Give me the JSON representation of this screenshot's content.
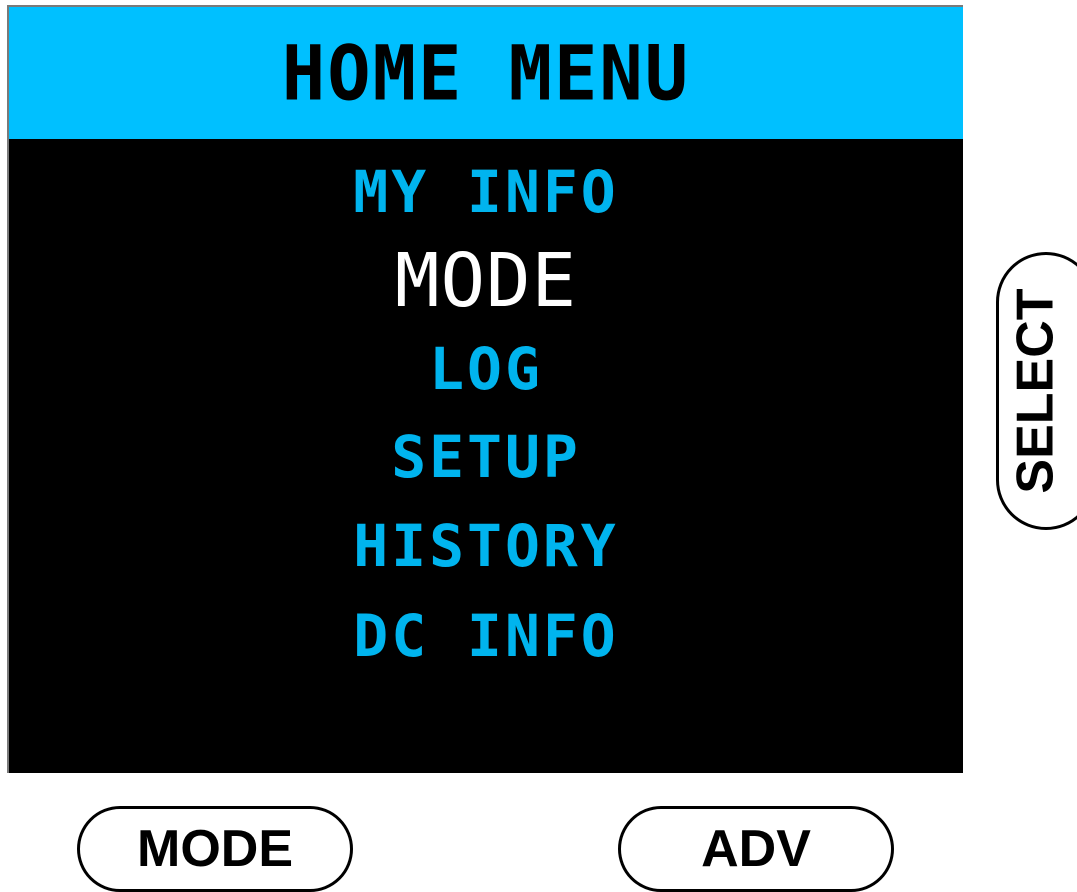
{
  "title": "HOME MENU",
  "menu": {
    "items": [
      {
        "label": "MY INFO",
        "selected": false
      },
      {
        "label": "MODE",
        "selected": true
      },
      {
        "label": "LOG",
        "selected": false
      },
      {
        "label": "SETUP",
        "selected": false
      },
      {
        "label": "HISTORY",
        "selected": false
      },
      {
        "label": "DC INFO",
        "selected": false
      }
    ]
  },
  "buttons": {
    "mode_label": "MODE",
    "adv_label": "ADV",
    "select_label": "SELECT"
  },
  "colors": {
    "title_bar_bg": "#00c0ff",
    "screen_bg": "#000000",
    "menu_item": "#00b4ee",
    "menu_item_selected": "#ffffff",
    "title_text": "#000000"
  }
}
